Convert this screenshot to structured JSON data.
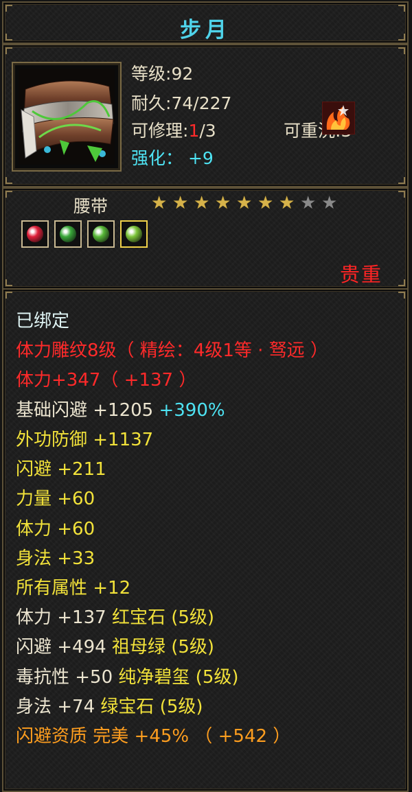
{
  "title": "步月",
  "item": {
    "level_label": "等级",
    "level_value": "92",
    "durability_label": "耐久",
    "durability_value": "74/227",
    "repair_label": "可修理",
    "repair_used": "1",
    "repair_total": "/3",
    "rewash_label": "可重洗",
    "rewash_value": "3",
    "enhance_label": "强化：",
    "enhance_value": "+9",
    "type": "腰带",
    "stars_filled": 7,
    "stars_total": 9,
    "quality": "贵重",
    "icon": "belt-icon",
    "badge_icon": "fire-talent-icon"
  },
  "gems": [
    {
      "name": "ruby-gem-icon",
      "color": "#e0203a",
      "selected": false
    },
    {
      "name": "emerald-gem-icon",
      "color": "#3aa83a",
      "selected": false
    },
    {
      "name": "emerald-gem-icon",
      "color": "#58b838",
      "selected": false
    },
    {
      "name": "jade-gem-icon",
      "color": "#7cc43a",
      "selected": true
    }
  ],
  "attributes": {
    "bound": "已绑定",
    "engrave": "体力雕纹8级（ 精绘：4级1等 · 驽远 ）",
    "stamina_total": "体力+347（ +137 ）",
    "base_dodge_label": "基础闪避  +1205",
    "base_dodge_pct": "+390%",
    "outer_def": "外功防御  +1137",
    "dodge": "闪避  +211",
    "strength": "力量  +60",
    "stamina": "体力  +60",
    "agility": "身法  +33",
    "all_attr": "所有属性  +12",
    "gem1_stat": "体力  +137  ",
    "gem1_name": "红宝石 (5级)",
    "gem2_stat": "闪避  +494  ",
    "gem2_name": "祖母绿 (5级)",
    "gem3_stat": "毒抗性  +50  ",
    "gem3_name": "纯净碧玺 (5级)",
    "gem4_stat": "身法  +74  ",
    "gem4_name": "绿宝石 (5级)",
    "aptitude": "闪避资质   完美  +45% （ +542 ）"
  },
  "colors": {
    "title": "#4fd3ea",
    "red": "#ff2a2a",
    "yellow": "#f2e23a",
    "cyan": "#4ee3f3",
    "orange": "#ff9e1f"
  }
}
